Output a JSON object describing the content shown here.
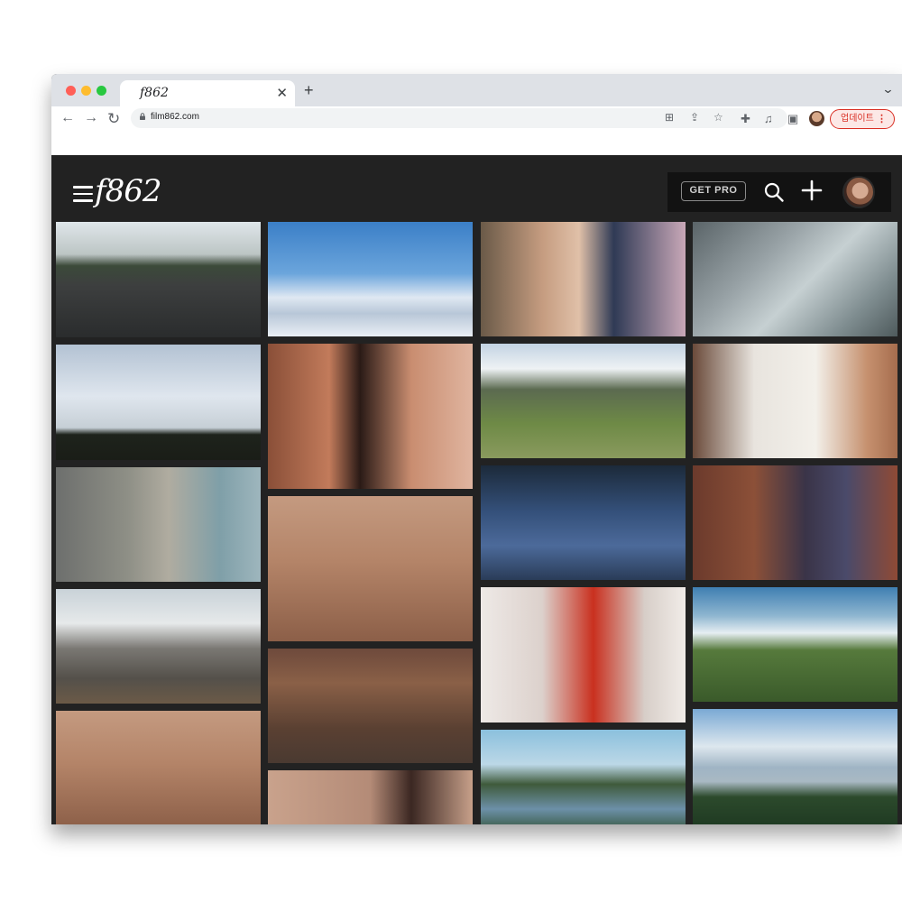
{
  "browser": {
    "tab_title": "f862",
    "url": "film862.com",
    "update_label": "업데이트",
    "icons": [
      "back-arrow-icon",
      "forward-arrow-icon",
      "reload-icon",
      "lock-icon",
      "translate-icon",
      "share-icon",
      "star-icon",
      "extensions-icon",
      "media-icon",
      "sidepanel-icon",
      "more-vert-icon"
    ]
  },
  "app": {
    "logo": "f862",
    "get_pro_label": "GET PRO",
    "icons": [
      "menu-icon",
      "search-icon",
      "plus-icon",
      "avatar"
    ]
  },
  "gallery": {
    "columns": [
      [
        {
          "id": "road-sunset",
          "kind": "road"
        },
        {
          "id": "hikers-ridge",
          "kind": "silhouette"
        },
        {
          "id": "backpacker-mountain",
          "kind": "backpacker"
        },
        {
          "id": "dolomite-ridge",
          "kind": "peaks"
        },
        {
          "id": "children-wall",
          "kind": "warm-room"
        }
      ],
      [
        {
          "id": "snow-glacier-hikers",
          "kind": "snow"
        },
        {
          "id": "girl-portrait",
          "kind": "girl"
        },
        {
          "id": "two-girls-playing",
          "kind": "warm-room"
        },
        {
          "id": "woman-sitting-room",
          "kind": "room-wood"
        },
        {
          "id": "girl-reading",
          "kind": "warm-face"
        }
      ],
      [
        {
          "id": "girl-and-father",
          "kind": "closeup"
        },
        {
          "id": "alpine-valley",
          "kind": "valley"
        },
        {
          "id": "boots-trail",
          "kind": "boots"
        },
        {
          "id": "girl-behind-bars",
          "kind": "bars"
        },
        {
          "id": "lake-forest",
          "kind": "lake"
        }
      ],
      [
        {
          "id": "misty-mountain",
          "kind": "mist"
        },
        {
          "id": "hand-on-book",
          "kind": "book"
        },
        {
          "id": "girl-brick-wall",
          "kind": "brick"
        },
        {
          "id": "hiker-hillside",
          "kind": "hill"
        },
        {
          "id": "mountain-lake-snow",
          "kind": "snowlake"
        }
      ]
    ]
  }
}
